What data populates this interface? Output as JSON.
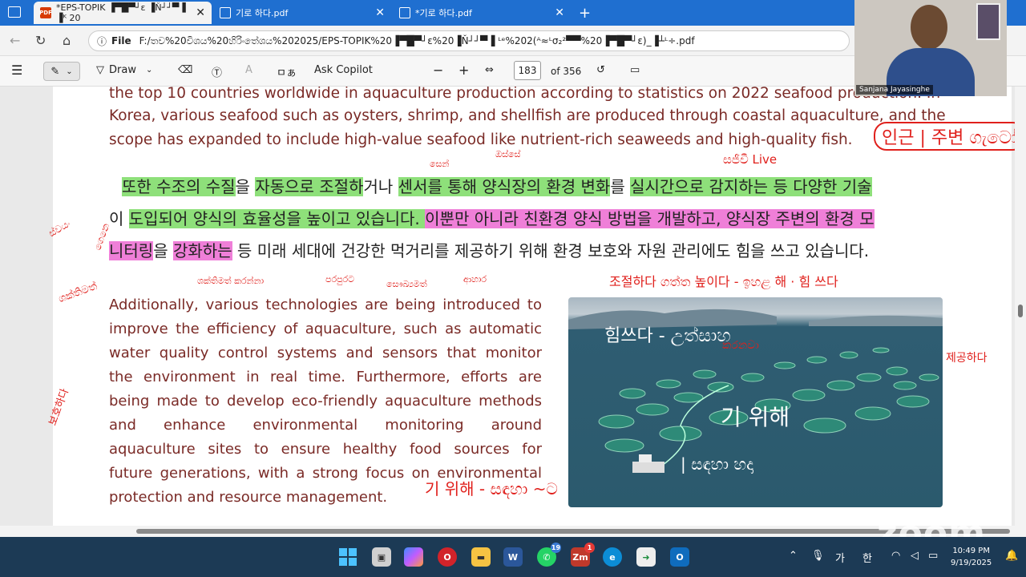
{
  "tabs": [
    {
      "label": "*EPS-TOPIK ▐▀█▀┘ε ▐Ň┘┘▀▐ ▐ᴷ 20",
      "active": true
    },
    {
      "label": "기로 하다.pdf",
      "active": false
    },
    {
      "label": "*기로 하다.pdf",
      "active": false
    }
  ],
  "address": {
    "prefix": "File",
    "url": "F:/තව%20විශය%20හිරිංතේශය%202025/EPS-TOPIK%20▐▀█▀┘ε%20▐Ň┘┘▀▐ ᴸᵉ%202(ᴬ≈ᴸσ₂²▀▀%20▐▀█▀┘ε)_▐┴ᴸ÷.pdf"
  },
  "toolbar": {
    "draw": "Draw",
    "ask_copilot": "Ask Copilot",
    "zoom_out": "−",
    "zoom_in": "+",
    "page_number": "183",
    "page_total": "of 356",
    "script_label": "ㅁぁ"
  },
  "document": {
    "intro_lines": [
      "the top 10 countries worldwide in aquaculture production according to statistics on 2022 seafood production. In",
      "Korea, various seafood such as oysters, shrimp, and shellfish are produced through coastal aquaculture, and the",
      "scope has expanded to include high-value seafood like nutrient-rich seaweeds and high-quality fish."
    ],
    "korean_line1": [
      {
        "t": "또한 ",
        "h": "g"
      },
      {
        "t": "수조의 ",
        "h": "g"
      },
      {
        "t": "수질",
        "h": "g"
      },
      {
        "t": "을 ",
        "h": ""
      },
      {
        "t": "자동으로 ",
        "h": "g"
      },
      {
        "t": "조절하",
        "h": "g"
      },
      {
        "t": "거나 ",
        "h": ""
      },
      {
        "t": "센서를 ",
        "h": "g"
      },
      {
        "t": "통해 ",
        "h": "g"
      },
      {
        "t": "양식장의 ",
        "h": "g"
      },
      {
        "t": "환경 ",
        "h": "g"
      },
      {
        "t": "변화",
        "h": "g"
      },
      {
        "t": "를 ",
        "h": ""
      },
      {
        "t": "실시간으로 ",
        "h": "g"
      },
      {
        "t": "감지하는 ",
        "h": "g"
      },
      {
        "t": "등 ",
        "h": "g"
      },
      {
        "t": "다양한 ",
        "h": "g"
      },
      {
        "t": "기술",
        "h": "g"
      }
    ],
    "korean_line2": [
      {
        "t": "이 ",
        "h": ""
      },
      {
        "t": "도입되어 ",
        "h": "g"
      },
      {
        "t": "양식의 ",
        "h": "g"
      },
      {
        "t": "효율성을 ",
        "h": "g"
      },
      {
        "t": "높이고 ",
        "h": "g"
      },
      {
        "t": "있습니다. ",
        "h": "g"
      },
      {
        "t": "이뿐만 아니라 ",
        "h": "p"
      },
      {
        "t": "친환경 ",
        "h": "p"
      },
      {
        "t": "양식 ",
        "h": "p"
      },
      {
        "t": "방법을 ",
        "h": "p"
      },
      {
        "t": "개발하고, ",
        "h": "p"
      },
      {
        "t": "양식장 ",
        "h": "p"
      },
      {
        "t": "주변의 ",
        "h": "p"
      },
      {
        "t": "환경 ",
        "h": "p"
      },
      {
        "t": "모",
        "h": "p"
      }
    ],
    "korean_line3": [
      {
        "t": "니터링",
        "h": "p"
      },
      {
        "t": "을 ",
        "h": ""
      },
      {
        "t": "강화하는",
        "h": "p"
      },
      {
        "t": " 등 미래 세대에 건강한 먹거리를 제공하기 위해 환경 보호와 자원 관리에도 힘을 쓰고 있습니다.",
        "h": ""
      }
    ],
    "english_lines": [
      "Additionally, various technologies are being introduced to",
      "improve the efficiency of aquaculture, such as automatic",
      "water quality control systems and sensors that monitor",
      "the environment in real time. Furthermore, efforts are",
      "being made to develop eco-friendly aquaculture methods",
      "and enhance environmental monitoring around",
      "aquaculture sites to ensure healthy food sources for",
      "future generations, with a strong focus on environmental",
      "protection and resource management."
    ]
  },
  "annotations": {
    "top_right": "인근 | 주변 ගැටෝ",
    "live": "සජීවී Live",
    "sensor": "සෙන්",
    "through": "ඔස්සේ",
    "ko_row": "조절하다 ගත්ත   높이다 - ඉහළ  해  · 힘 쓰다",
    "left1": "ස්වයං",
    "left2": "ගෙනෙ",
    "left3": "ශක්තිමත්",
    "under1": "ශක්තිමත් කරන්නා",
    "under2": "පරපුරට",
    "under3": "සෞඛ්‍යමත්",
    "under4": "ආහාර",
    "left_side": "보호하다",
    "right_side": "제공하다",
    "bottom": "기 위해 - සඳහා  ~ට",
    "photo1": "힘쓰다 - උත්සාහ",
    "photo2": "කරනවා",
    "photo3": "기 위해",
    "photo4": "| සඳහා හදා"
  },
  "video": {
    "name": "Sanjana Jayasinghe"
  },
  "taskbar": {
    "ime_lang": "가",
    "ime_mode": "한",
    "time": "10:49 PM",
    "date": "9/19/2025",
    "whatsapp_badge": "19",
    "zoom_badge": "1"
  },
  "watermark": "zoom"
}
